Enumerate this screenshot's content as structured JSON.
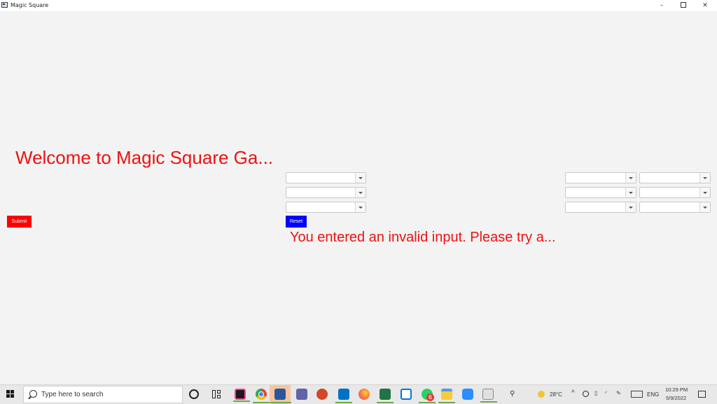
{
  "window": {
    "title": "Magic Square",
    "controls": {
      "minimize": "–",
      "close": "✕"
    }
  },
  "main": {
    "welcome_text": "Welcome to Magic Square Ga...",
    "submit_label": "Submit",
    "reset_label": "Reset",
    "error_text": "You entered an invalid input. Please try a..."
  },
  "taskbar": {
    "search_placeholder": "Type here to search",
    "weather": "28°C",
    "language": "ENG",
    "time": "10:29 PM",
    "date": "5/9/2022",
    "whatsapp_badge": "6",
    "pinned_icons": [
      "cortana-icon",
      "task-view-icon",
      "jetbrains-icon",
      "chrome-icon",
      "word-icon",
      "teams-icon",
      "powerpoint-icon",
      "outlook-icon",
      "firefox-icon",
      "excel-icon",
      "vscode-icon",
      "whatsapp-icon",
      "file-explorer-icon",
      "zoom-icon",
      "java-app-icon"
    ],
    "colors": {
      "accent_green": "#6aa84f"
    }
  }
}
